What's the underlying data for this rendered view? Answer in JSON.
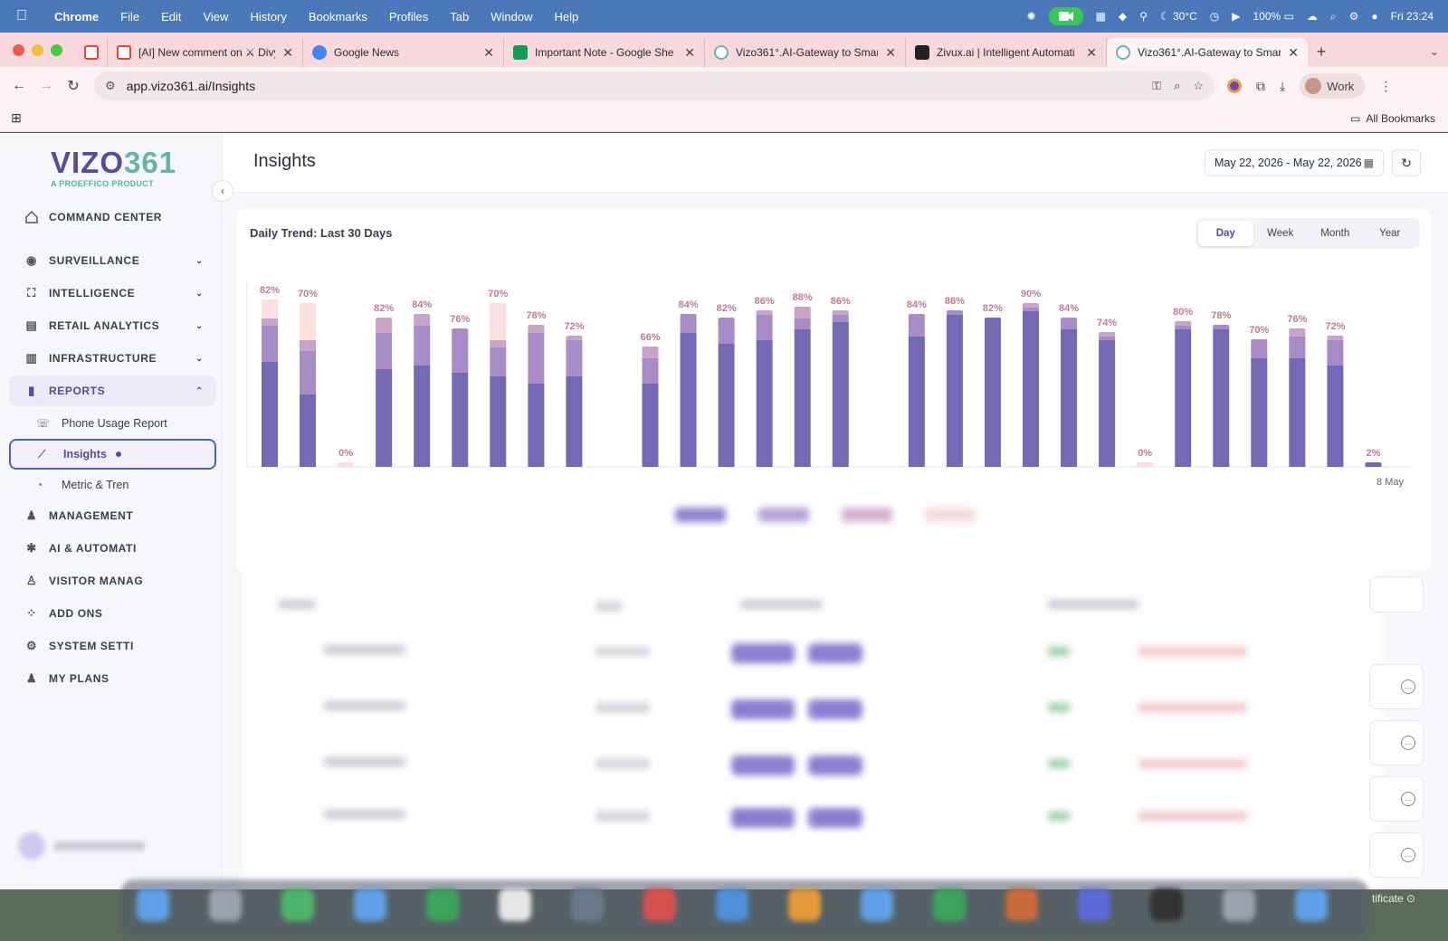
{
  "menubar": {
    "app": "Chrome",
    "items": [
      "File",
      "Edit",
      "View",
      "History",
      "Bookmarks",
      "Profiles",
      "Tab",
      "Window",
      "Help"
    ],
    "temperature": "30°C",
    "battery": "100%",
    "datetime": "Fri 23:24"
  },
  "tabs": [
    {
      "title": "",
      "favicon_color": "#ea4335"
    },
    {
      "title": "[AI] New comment on ⚔ Divy",
      "favicon_color": "#ea4335"
    },
    {
      "title": "Google News",
      "favicon_color": "#4285f4"
    },
    {
      "title": "Important Note - Google She",
      "favicon_color": "#0f9d58"
    },
    {
      "title": "Vizo361°.AI-Gateway to Smar",
      "favicon_color": "#64b7a7"
    },
    {
      "title": "Zivux.ai | Intelligent Automati",
      "favicon_color": "#222222"
    },
    {
      "title": "Vizo361°.AI-Gateway to Smar",
      "favicon_color": "#64b7a7"
    }
  ],
  "toolbar": {
    "url": "app.vizo361.ai/Insights",
    "profile_label": "Work"
  },
  "bookmarks": {
    "all_label": "All Bookmarks"
  },
  "sidebar": {
    "logo_part1": "VIZO",
    "logo_part2": "361",
    "logo_tagline": "A PROEFFICO PRODUCT",
    "items": [
      {
        "label": "COMMAND CENTER",
        "icon": "home-icon",
        "chevron": ""
      },
      {
        "label": "SURVEILLANCE",
        "icon": "camera-icon",
        "chevron": "⌄"
      },
      {
        "label": "INTELLIGENCE",
        "icon": "scan-icon",
        "chevron": "⌄"
      },
      {
        "label": "RETAIL ANALYTICS",
        "icon": "store-icon",
        "chevron": "⌄"
      },
      {
        "label": "INFRASTRUCTURE",
        "icon": "building-icon",
        "chevron": "⌄"
      },
      {
        "label": "REPORTS",
        "icon": "report-icon",
        "chevron": "⌃"
      }
    ],
    "sub_items": [
      {
        "label": "Phone Usage Report",
        "icon": "phone-icon"
      },
      {
        "label": "Insights",
        "icon": "trend-icon"
      },
      {
        "label": "Metric & Tren",
        "icon": "metric-icon"
      }
    ],
    "items_after": [
      {
        "label": "MANAGEMENT",
        "icon": "users-icon"
      },
      {
        "label": "AI & AUTOMATI",
        "icon": "ai-icon"
      },
      {
        "label": "VISITOR MANAG",
        "icon": "visitor-icon"
      },
      {
        "label": "ADD ONS",
        "icon": "addons-icon"
      },
      {
        "label": "SYSTEM SETTI",
        "icon": "settings-icon"
      },
      {
        "label": "MY PLANS",
        "icon": "plans-icon"
      }
    ]
  },
  "page": {
    "title": "Insights",
    "date_range": "May 22, 2026 - May 22, 2026"
  },
  "chart_card": {
    "title": "Daily Trend: Last 30 Days",
    "periods": [
      "Day",
      "Week",
      "Month",
      "Year"
    ],
    "active_period": "Day",
    "last_tick_label": "8 May"
  },
  "chart_data": {
    "type": "bar",
    "stacked": true,
    "title": "Daily Trend: Last 30 Days",
    "ylim": [
      0,
      100
    ],
    "colors": [
      "#7469b5",
      "#a88cc8",
      "#c9a3c8",
      "#fbe0e0"
    ],
    "data_labels": [
      "82%",
      "70%",
      "0%",
      "82%",
      "84%",
      "76%",
      "70%",
      "78%",
      "72%",
      null,
      "66%",
      "84%",
      "82%",
      "86%",
      "88%",
      "86%",
      null,
      "84%",
      "86%",
      "82%",
      "90%",
      "84%",
      "74%",
      "0%",
      "80%",
      "78%",
      "70%",
      "76%",
      "72%",
      "2%"
    ],
    "stacks": [
      [
        58,
        20,
        4,
        10
      ],
      [
        40,
        24,
        6,
        20
      ],
      [
        0,
        0,
        0,
        2
      ],
      [
        54,
        20,
        8,
        0
      ],
      [
        56,
        22,
        6,
        0
      ],
      [
        52,
        24,
        0,
        0
      ],
      [
        50,
        16,
        4,
        20
      ],
      [
        46,
        28,
        4,
        0
      ],
      [
        50,
        20,
        2,
        0
      ],
      [
        0,
        0,
        0,
        0
      ],
      [
        46,
        14,
        6,
        0
      ],
      [
        74,
        10,
        0,
        0
      ],
      [
        68,
        14,
        0,
        0
      ],
      [
        70,
        14,
        2,
        0
      ],
      [
        76,
        6,
        6,
        0
      ],
      [
        80,
        4,
        2,
        0
      ],
      [
        0,
        0,
        0,
        0
      ],
      [
        72,
        12,
        0,
        0
      ],
      [
        84,
        2,
        0,
        0
      ],
      [
        82,
        0,
        0,
        0
      ],
      [
        86,
        2,
        2,
        0
      ],
      [
        76,
        6,
        0,
        0
      ],
      [
        70,
        2,
        2,
        0
      ],
      [
        0,
        0,
        0,
        2
      ],
      [
        76,
        2,
        2,
        0
      ],
      [
        76,
        2,
        0,
        0
      ],
      [
        60,
        10,
        0,
        0
      ],
      [
        60,
        12,
        4,
        0
      ],
      [
        56,
        14,
        2,
        0
      ],
      [
        2,
        0,
        0,
        0
      ]
    ]
  }
}
